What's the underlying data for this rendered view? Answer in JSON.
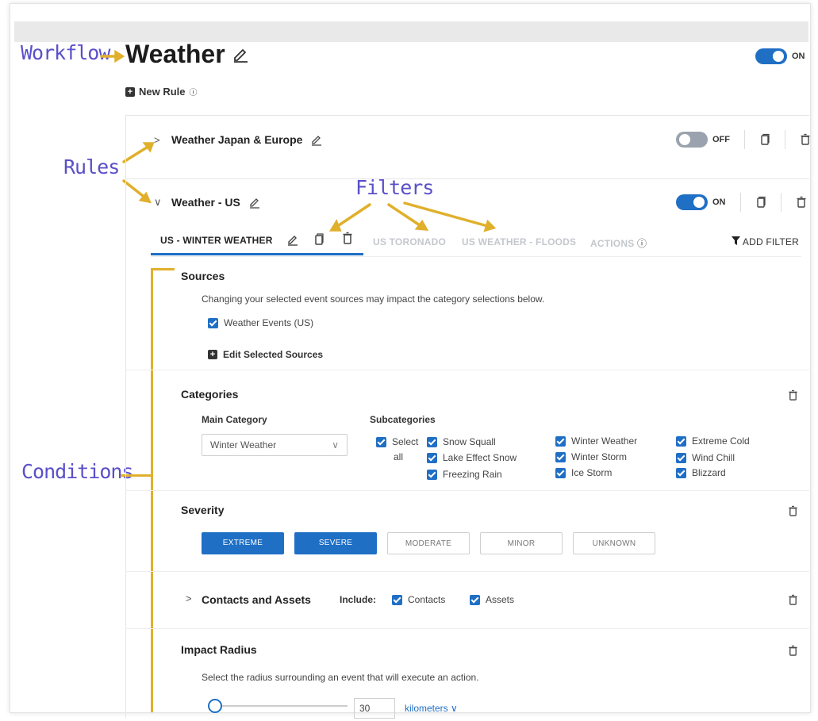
{
  "annotations": {
    "workflow": "Workflow",
    "rules": "Rules",
    "filters": "Filters",
    "conditions": "Conditions"
  },
  "workflow": {
    "title": "Weather",
    "toggle_label": "ON"
  },
  "new_rule_label": "New Rule",
  "info_glyph": "ⓘ",
  "rules": [
    {
      "name": "Weather Japan & Europe",
      "toggle_label": "OFF",
      "state": "off"
    },
    {
      "name": "Weather - US",
      "toggle_label": "ON",
      "state": "on"
    }
  ],
  "tabs": {
    "active": "US - WINTER WEATHER",
    "others": [
      "US TORONADO",
      "US WEATHER - FLOODS",
      "ACTIONS"
    ],
    "add_filter": "ADD FILTER"
  },
  "sources": {
    "title": "Sources",
    "note": "Changing your selected event sources may impact the category selections below.",
    "items": [
      "Weather Events (US)"
    ],
    "edit_label": "Edit Selected Sources"
  },
  "categories": {
    "title": "Categories",
    "main_label": "Main Category",
    "main_value": "Winter Weather",
    "sub_label": "Subcategories",
    "select_all_1": "Select",
    "select_all_2": "all",
    "col1": [
      "Snow Squall",
      "Lake Effect Snow",
      "Freezing Rain"
    ],
    "col2": [
      "Winter Weather",
      "Winter Storm",
      "Ice Storm"
    ],
    "col3": [
      "Extreme Cold",
      "Wind Chill",
      "Blizzard"
    ]
  },
  "severity": {
    "title": "Severity",
    "options": [
      "EXTREME",
      "SEVERE",
      "MODERATE",
      "MINOR",
      "UNKNOWN"
    ],
    "selected_count": 2
  },
  "contacts": {
    "title": "Contacts and Assets",
    "include_label": "Include:",
    "contacts_label": "Contacts",
    "assets_label": "Assets"
  },
  "impact": {
    "title": "Impact Radius",
    "note": "Select the radius surrounding an event that will execute an action.",
    "value": "30",
    "unit": "kilometers"
  },
  "colors": {
    "accent": "#1f6fc5",
    "annotation": "#5a50c9",
    "annotation_line": "#e0b02c"
  }
}
